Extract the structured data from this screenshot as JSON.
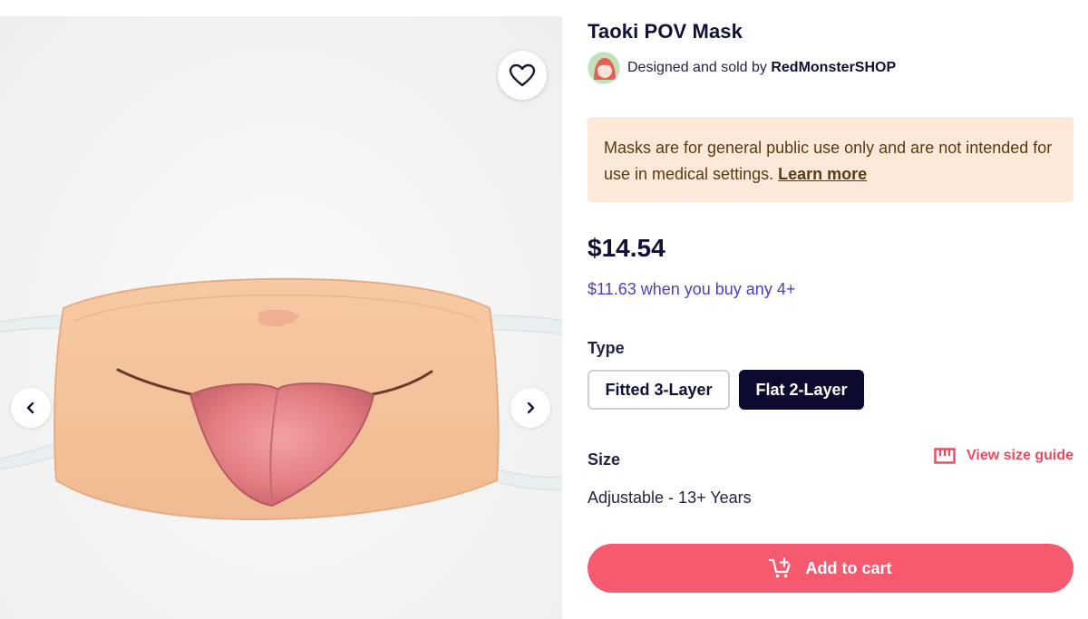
{
  "product": {
    "title": "Taoki POV Mask",
    "designer_prefix": "Designed and sold by",
    "designer_name": "RedMonsterSHOP"
  },
  "notice": {
    "text": "Masks are for general public use only and are not intended for use in medical settings.",
    "link_label": "Learn more",
    "background_color": "#fde9da"
  },
  "pricing": {
    "price": "$14.54",
    "bulk_offer": "$11.63 when you buy any 4+"
  },
  "type_section": {
    "label": "Type",
    "options": [
      {
        "label": "Fitted 3-Layer",
        "selected": false
      },
      {
        "label": "Flat 2-Layer",
        "selected": true
      }
    ]
  },
  "size_section": {
    "label": "Size",
    "guide_label": "View size guide",
    "value": "Adjustable - 13+ Years"
  },
  "cart": {
    "label": "Add to cart",
    "color": "#f65a6e"
  },
  "icons": {
    "favorite": "heart-icon",
    "previous": "chevron-left-icon",
    "next": "chevron-right-icon",
    "size_guide": "ruler-icon",
    "cart": "cart-add-icon"
  }
}
